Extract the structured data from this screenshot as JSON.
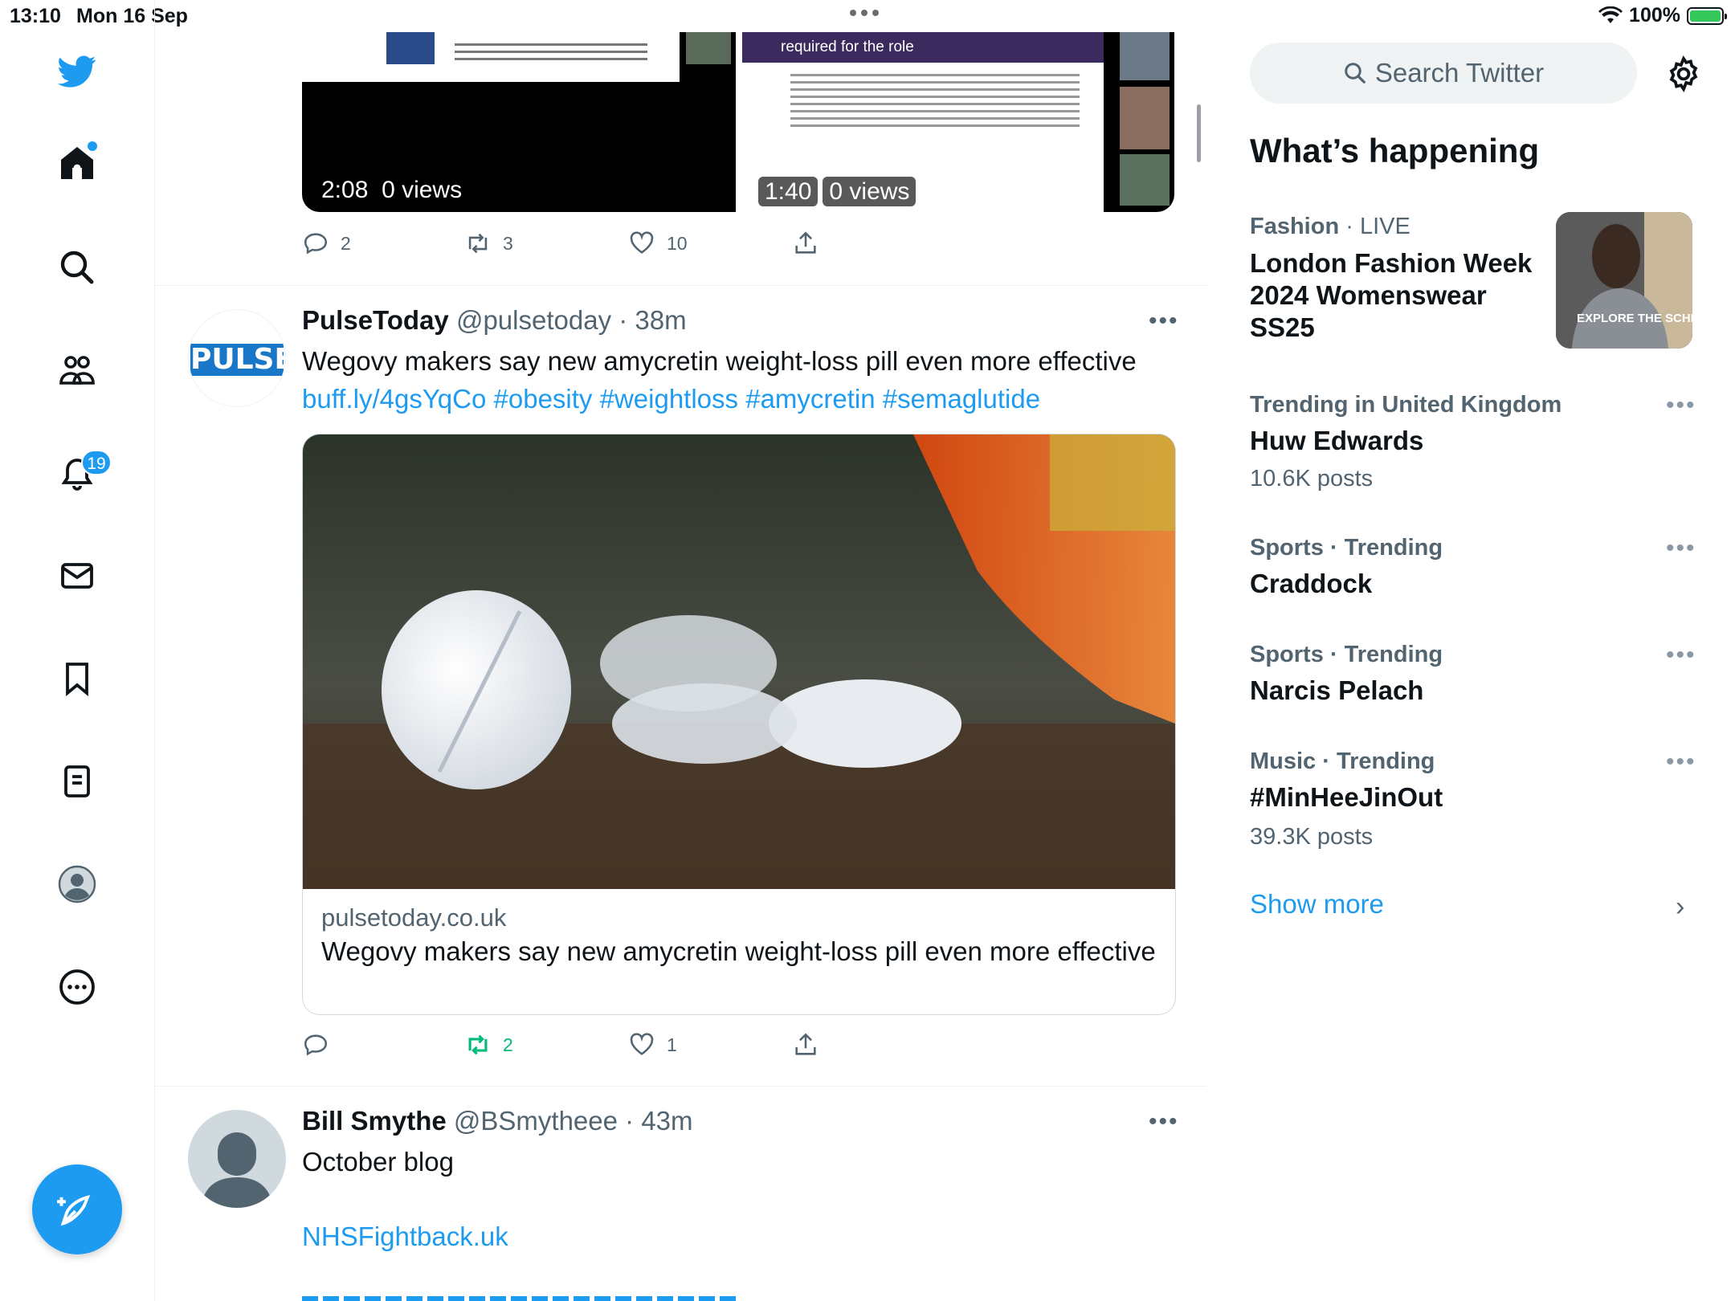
{
  "status_bar": {
    "time": "13:10",
    "date": "Mon 16 Sep",
    "battery": "100%"
  },
  "nav": {
    "notifications_badge": "19"
  },
  "tweets": [
    {
      "video_left": {
        "duration": "2:08",
        "views": "0 views"
      },
      "video_right": {
        "duration": "1:40",
        "views": "0 views",
        "slide_heading": "required for the role"
      },
      "reply_count": "2",
      "retweet_count": "3",
      "like_count": "10"
    },
    {
      "name": "PulseToday",
      "handle": "@pulsetoday",
      "time": "38m",
      "avatar_text": "PULSE",
      "text": "Wegovy makers say new amycretin weight-loss pill even more effective",
      "link": "buff.ly/4gsYqCo",
      "hashtags": [
        "#obesity",
        "#weightloss",
        "#amycretin",
        "#semaglutide"
      ],
      "card": {
        "domain": "pulsetoday.co.uk",
        "title": "Wegovy makers say new amycretin weight-loss pill even more effective"
      },
      "reply_count": "",
      "retweet_count": "2",
      "like_count": "1"
    },
    {
      "name": "Bill Smythe",
      "handle": "@BSmytheee",
      "time": "43m",
      "text": "October blog",
      "link": "NHSFightback.uk"
    }
  ],
  "sidebar": {
    "search_placeholder": "Search Twitter",
    "heading": "What’s happening",
    "trends": [
      {
        "category": "Fashion",
        "status": "LIVE",
        "title": "London Fashion Week 2024 Womenswear SS25",
        "image_caption": "EXPLORE THE SCHEDUL"
      },
      {
        "category": "Trending in United Kingdom",
        "title": "Huw Edwards",
        "posts": "10.6K posts"
      },
      {
        "category": "Sports · Trending",
        "title": "Craddock"
      },
      {
        "category": "Sports · Trending",
        "title": "Narcis Pelach"
      },
      {
        "category": "Music · Trending",
        "title": "#MinHeeJinOut",
        "posts": "39.3K posts"
      }
    ],
    "show_more": "Show more"
  },
  "colors": {
    "brand": "#1d9bf0",
    "retweet_active": "#00ba7c",
    "text": "#0f1419",
    "muted": "#536471"
  },
  "icons": [
    "twitter-logo-icon",
    "home-icon",
    "search-icon",
    "communities-icon",
    "notifications-icon",
    "messages-icon",
    "bookmarks-icon",
    "lists-icon",
    "profile-icon",
    "more-icon",
    "compose-icon",
    "reply-icon",
    "retweet-icon",
    "like-icon",
    "share-icon",
    "gear-icon",
    "wifi-icon",
    "battery-icon",
    "chevron-right-icon"
  ]
}
